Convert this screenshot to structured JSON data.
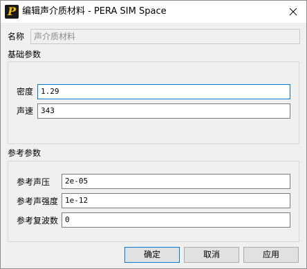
{
  "window": {
    "title": "编辑声介质材料 - PERA SIM Space",
    "app_icon_glyph": "P"
  },
  "name_row": {
    "label": "名称",
    "value": "声介质材料"
  },
  "basic": {
    "title": "基础参数",
    "density_label": "密度",
    "density_value": "1.29",
    "speed_label": "声速",
    "speed_value": "343"
  },
  "reference": {
    "title": "参考参数",
    "pressure_label": "参考声压",
    "pressure_value": "2e-05",
    "intensity_label": "参考声强度",
    "intensity_value": "1e-12",
    "wavenumber_label": "参考复波数",
    "wavenumber_value": "0"
  },
  "buttons": {
    "ok": "确定",
    "cancel": "取消",
    "apply": "应用"
  },
  "colors": {
    "focus_border": "#0078d7",
    "icon_bg": "#1a1a1a",
    "icon_glyph": "#f2c200"
  }
}
